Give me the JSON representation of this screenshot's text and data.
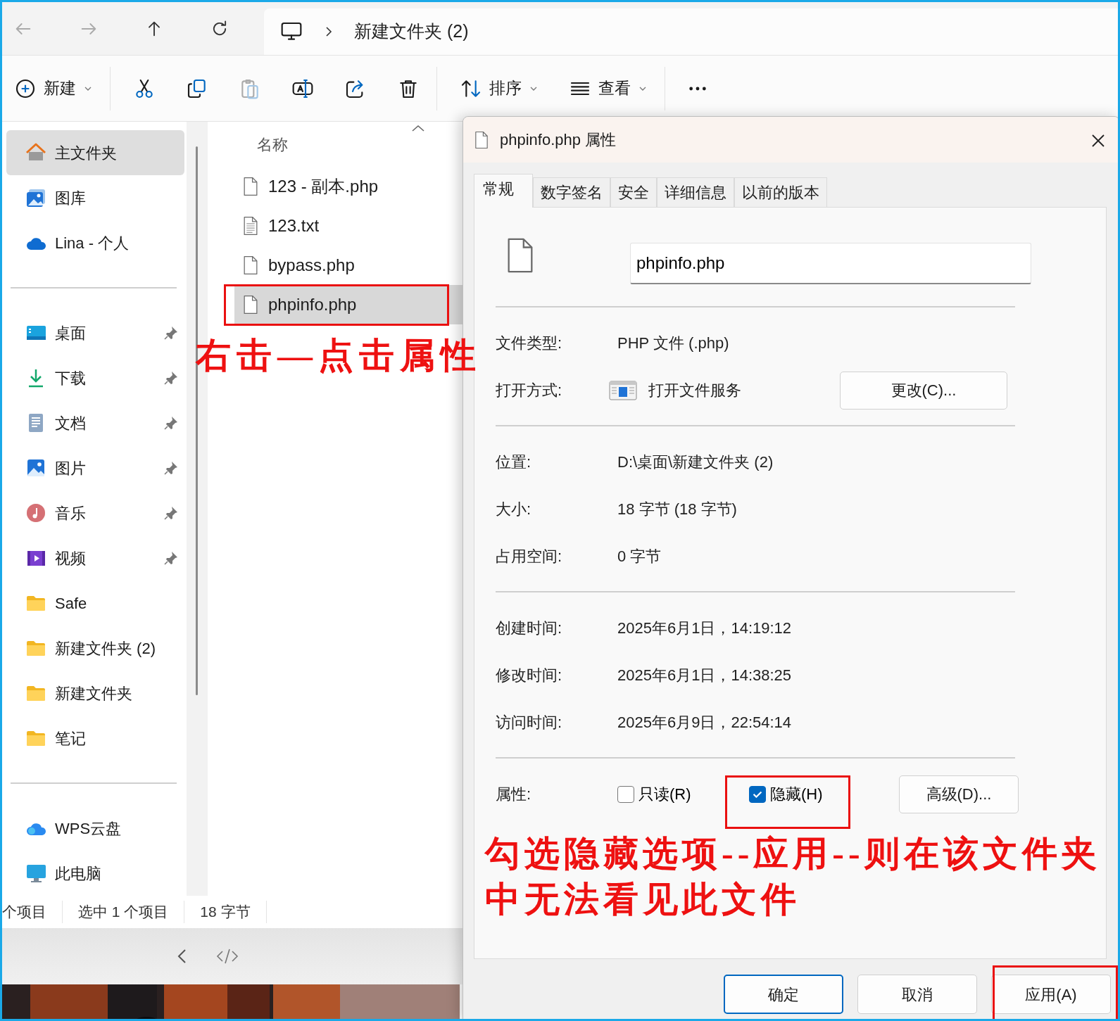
{
  "address_bar": {
    "nav": [
      {
        "kind": "back",
        "disabled": true
      },
      {
        "kind": "forward",
        "disabled": true
      },
      {
        "kind": "up",
        "disabled": false
      },
      {
        "kind": "refresh",
        "disabled": false
      }
    ],
    "path": [
      "新建文件夹 (2)"
    ]
  },
  "toolbar": {
    "groups": [
      [
        {
          "kind": "new",
          "label": "新建",
          "dropdown": true,
          "disabled": false
        }
      ],
      [
        {
          "kind": "cut",
          "disabled": false
        },
        {
          "kind": "copy",
          "disabled": false
        },
        {
          "kind": "paste",
          "disabled": true
        },
        {
          "kind": "rename",
          "disabled": false
        },
        {
          "kind": "share",
          "disabled": false
        },
        {
          "kind": "delete",
          "disabled": false
        }
      ],
      [
        {
          "kind": "sort",
          "label": "排序",
          "dropdown": true,
          "disabled": false
        },
        {
          "kind": "view",
          "label": "查看",
          "dropdown": true,
          "disabled": false
        }
      ],
      [
        {
          "kind": "more",
          "disabled": false
        }
      ]
    ]
  },
  "sidebar": {
    "groups": [
      [
        {
          "kind": "home",
          "label": "主文件夹",
          "selected": true,
          "pinned": false
        },
        {
          "kind": "gallery",
          "label": "图库",
          "selected": false,
          "pinned": false
        },
        {
          "kind": "cloud",
          "label": "Lina - 个人",
          "selected": false,
          "pinned": false
        }
      ],
      [
        {
          "kind": "desktop",
          "label": "桌面",
          "selected": false,
          "pinned": true
        },
        {
          "kind": "download",
          "label": "下载",
          "selected": false,
          "pinned": true
        },
        {
          "kind": "documents",
          "label": "文档",
          "selected": false,
          "pinned": true
        },
        {
          "kind": "pictures",
          "label": "图片",
          "selected": false,
          "pinned": true
        },
        {
          "kind": "music",
          "label": "音乐",
          "selected": false,
          "pinned": true
        },
        {
          "kind": "videos",
          "label": "视频",
          "selected": false,
          "pinned": true
        },
        {
          "kind": "folder",
          "label": "Safe",
          "selected": false,
          "pinned": false
        },
        {
          "kind": "folder",
          "label": "新建文件夹 (2)",
          "selected": false,
          "pinned": false
        },
        {
          "kind": "folder",
          "label": "新建文件夹",
          "selected": false,
          "pinned": false
        },
        {
          "kind": "folder",
          "label": "笔记",
          "selected": false,
          "pinned": false
        }
      ],
      [
        {
          "kind": "wps",
          "label": "WPS云盘",
          "selected": false,
          "pinned": false
        },
        {
          "kind": "pc",
          "label": "此电脑",
          "selected": false,
          "pinned": false
        }
      ]
    ]
  },
  "file_list": {
    "column": "名称",
    "files": [
      {
        "name": "123 - 副本.php",
        "kind": "file",
        "selected": false
      },
      {
        "name": "123.txt",
        "kind": "text",
        "selected": false
      },
      {
        "name": "bypass.php",
        "kind": "file",
        "selected": false
      },
      {
        "name": "phpinfo.php",
        "kind": "file",
        "selected": true
      }
    ]
  },
  "status_bar": {
    "items": [
      "个项目",
      "选中 1 个项目",
      "18 字节"
    ]
  },
  "dialog": {
    "title": "phpinfo.php 属性",
    "tabs": [
      {
        "label": "常规",
        "selected": true
      },
      {
        "label": "数字签名",
        "selected": false
      },
      {
        "label": "安全",
        "selected": false
      },
      {
        "label": "详细信息",
        "selected": false
      },
      {
        "label": "以前的版本",
        "selected": false
      }
    ],
    "file_name": "phpinfo.php",
    "sections": [
      [
        {
          "label": "文件类型:",
          "value": "PHP 文件 (.php)"
        },
        {
          "label": "打开方式:",
          "value": "打开文件服务",
          "kind": "open_with",
          "button": "更改(C)..."
        }
      ],
      [
        {
          "label": "位置:",
          "value": "D:\\桌面\\新建文件夹 (2)"
        },
        {
          "label": "大小:",
          "value": "18 字节 (18 字节)"
        },
        {
          "label": "占用空间:",
          "value": "0 字节"
        }
      ],
      [
        {
          "label": "创建时间:",
          "value": "2025年6月1日，14:19:12"
        },
        {
          "label": "修改时间:",
          "value": "2025年6月1日，14:38:25"
        },
        {
          "label": "访问时间:",
          "value": "2025年6月9日，22:54:14"
        }
      ]
    ],
    "attributes": {
      "label": "属性:",
      "options": [
        {
          "label": "只读(R)",
          "checked": false
        },
        {
          "label": "隐藏(H)",
          "checked": true
        }
      ],
      "button": "高级(D)..."
    },
    "buttons": [
      {
        "label": "确定",
        "default": true
      },
      {
        "label": "取消",
        "default": false
      },
      {
        "label": "应用(A)",
        "default": false
      }
    ]
  },
  "annotations": [
    {
      "text": "右击—点击属性"
    },
    {
      "text": "勾选隐藏选项--应用--则在该文件夹中无法看见此文件"
    }
  ]
}
